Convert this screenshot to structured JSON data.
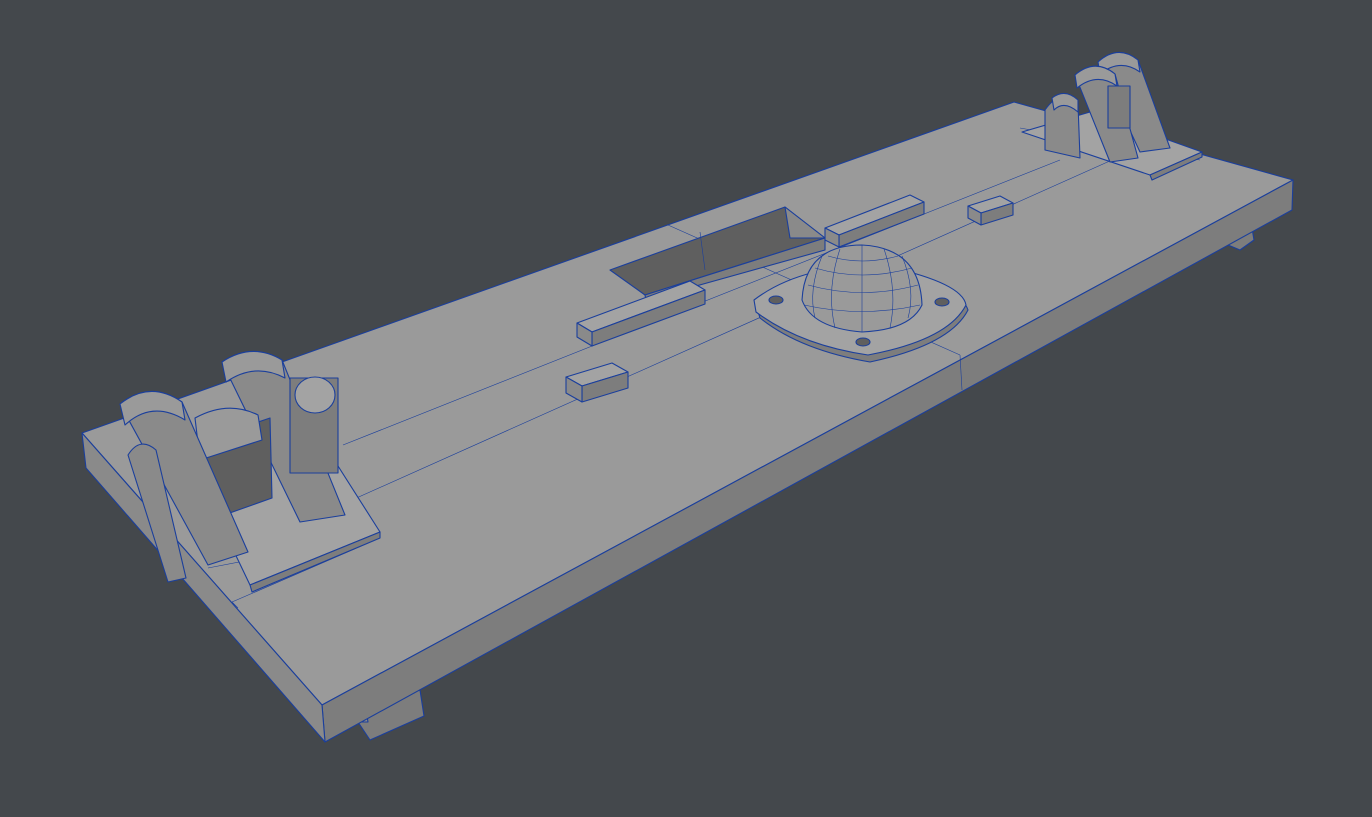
{
  "viewport": {
    "background_color": "#44484c",
    "wire_color": "#1b3f9c",
    "surface_colors": {
      "top": "#9a9a9a",
      "side": "#8a8a8a",
      "front": "#7d7d7d",
      "shadow": "#5f5f5f"
    }
  },
  "scene": {
    "object": "base-plate-with-hinges-and-dome"
  }
}
